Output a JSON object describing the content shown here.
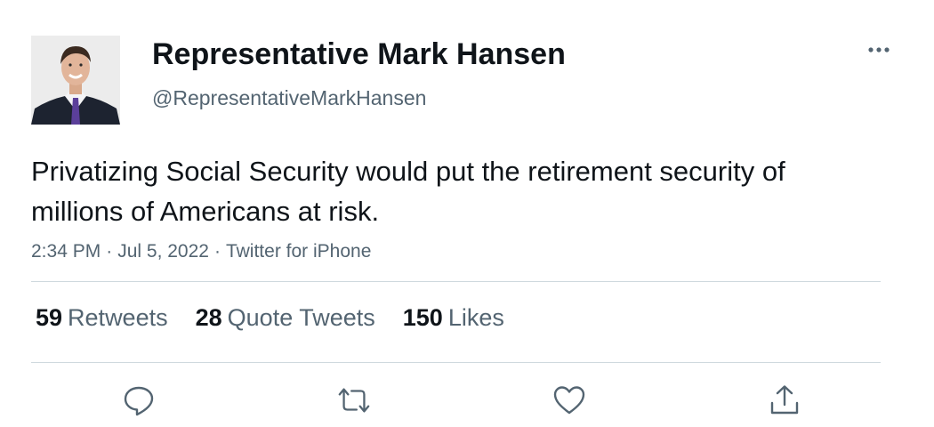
{
  "tweet": {
    "display_name": "Representative Mark Hansen",
    "handle": "@RepresentativeMarkHansen",
    "text": "Privatizing Social Security would put the retirement security of millions of Americans at risk.",
    "time": "2:34 PM",
    "date": "Jul 5, 2022",
    "source": "Twitter for iPhone",
    "separator": "·"
  },
  "stats": {
    "retweets_count": "59",
    "retweets_label": "Retweets",
    "quotes_count": "28",
    "quotes_label": "Quote Tweets",
    "likes_count": "150",
    "likes_label": "Likes"
  },
  "actions": {
    "reply_icon": "reply-icon",
    "retweet_icon": "retweet-icon",
    "like_icon": "heart-icon",
    "share_icon": "share-icon",
    "more_icon": "more-icon"
  },
  "colors": {
    "primary_text": "#0f1419",
    "secondary_text": "#536471",
    "divider": "#cfd9de",
    "icon": "#536471"
  }
}
